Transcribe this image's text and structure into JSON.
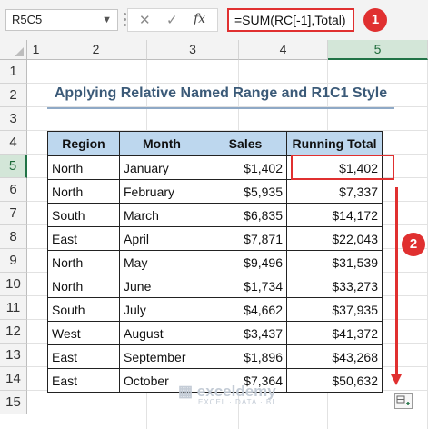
{
  "formula_bar": {
    "name_box": "R5C5",
    "formula": "=SUM(RC[-1],Total)",
    "cancel_icon": "close-icon",
    "enter_icon": "checkmark-icon",
    "fx_label": "fx"
  },
  "columns": [
    "1",
    "2",
    "3",
    "4",
    "5"
  ],
  "rows": [
    "1",
    "2",
    "3",
    "4",
    "5",
    "6",
    "7",
    "8",
    "9",
    "10",
    "11",
    "12",
    "13",
    "14",
    "15"
  ],
  "title": "Applying Relative Named Range and R1C1 Style",
  "table": {
    "headers": [
      "Region",
      "Month",
      "Sales",
      "Running Total"
    ],
    "rows": [
      {
        "region": "North",
        "month": "January",
        "sales": "$1,402",
        "total": "$1,402"
      },
      {
        "region": "North",
        "month": "February",
        "sales": "$5,935",
        "total": "$7,337"
      },
      {
        "region": "South",
        "month": "March",
        "sales": "$6,835",
        "total": "$14,172"
      },
      {
        "region": "East",
        "month": "April",
        "sales": "$7,871",
        "total": "$22,043"
      },
      {
        "region": "North",
        "month": "May",
        "sales": "$9,496",
        "total": "$31,539"
      },
      {
        "region": "North",
        "month": "June",
        "sales": "$1,734",
        "total": "$33,273"
      },
      {
        "region": "South",
        "month": "July",
        "sales": "$4,662",
        "total": "$37,935"
      },
      {
        "region": "West",
        "month": "August",
        "sales": "$3,437",
        "total": "$41,372"
      },
      {
        "region": "East",
        "month": "September",
        "sales": "$1,896",
        "total": "$43,268"
      },
      {
        "region": "East",
        "month": "October",
        "sales": "$7,364",
        "total": "$50,632"
      }
    ]
  },
  "annotations": {
    "badge1": "1",
    "badge2": "2",
    "color": "#e03030"
  },
  "watermark": {
    "name": "exceldemy",
    "tagline": "EXCEL · DATA · BI"
  }
}
